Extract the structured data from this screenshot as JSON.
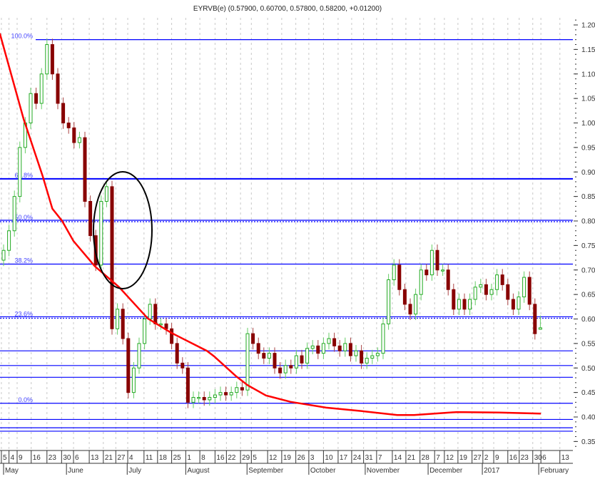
{
  "chart_data": {
    "type": "candlestick",
    "title": "EYRVB(e) (0.57900, 0.60700, 0.57800, 0.58200, +0.01200)",
    "last_bar": {
      "open": 0.579,
      "high": 0.607,
      "low": 0.578,
      "close": 0.582,
      "change": 0.012
    },
    "ylim": [
      0.33,
      1.215
    ],
    "y_ticks": [
      "1.20",
      "1.15",
      "1.10",
      "1.05",
      "1.00",
      "0.95",
      "0.90",
      "0.85",
      "0.80",
      "0.75",
      "0.70",
      "0.65",
      "0.60",
      "0.55",
      "0.50",
      "0.45",
      "0.40",
      "0.35"
    ],
    "y_tick_values": [
      1.2,
      1.15,
      1.1,
      1.05,
      1.0,
      0.95,
      0.9,
      0.85,
      0.8,
      0.75,
      0.7,
      0.65,
      0.6,
      0.55,
      0.5,
      0.45,
      0.4,
      0.35
    ],
    "x_day_ticks": [
      {
        "label": "5",
        "bar": -0.4
      },
      {
        "label": "4",
        "bar": 1.0
      },
      {
        "label": "9",
        "bar": 2.5
      },
      {
        "label": "16",
        "bar": 5.1
      },
      {
        "label": "23",
        "bar": 8.0
      },
      {
        "label": "30",
        "bar": 10.7
      },
      {
        "label": "6",
        "bar": 12.9
      },
      {
        "label": "13",
        "bar": 15.8
      },
      {
        "label": "21",
        "bar": 18.4
      },
      {
        "label": "27",
        "bar": 20.7
      },
      {
        "label": "4",
        "bar": 22.9
      },
      {
        "label": "11",
        "bar": 25.9
      },
      {
        "label": "18",
        "bar": 28.4
      },
      {
        "label": "25",
        "bar": 31.0
      },
      {
        "label": "1",
        "bar": 33.6
      },
      {
        "label": "8",
        "bar": 36.2
      },
      {
        "label": "16",
        "bar": 39.0
      },
      {
        "label": "22",
        "bar": 41.1
      },
      {
        "label": "29",
        "bar": 43.7
      },
      {
        "label": "5",
        "bar": 45.7
      },
      {
        "label": "12",
        "bar": 48.7
      },
      {
        "label": "19",
        "bar": 51.3
      },
      {
        "label": "26",
        "bar": 53.9
      },
      {
        "label": "3",
        "bar": 56.3
      },
      {
        "label": "10",
        "bar": 59.0
      },
      {
        "label": "17",
        "bar": 61.7
      },
      {
        "label": "24",
        "bar": 64.2
      },
      {
        "label": "31",
        "bar": 66.4
      },
      {
        "label": "7",
        "bar": 68.8
      },
      {
        "label": "14",
        "bar": 71.7
      },
      {
        "label": "21",
        "bar": 74.2
      },
      {
        "label": "28",
        "bar": 76.8
      },
      {
        "label": "7",
        "bar": 79.5
      },
      {
        "label": "12",
        "bar": 81.3
      },
      {
        "label": "19",
        "bar": 83.8
      },
      {
        "label": "27",
        "bar": 86.4
      },
      {
        "label": "2",
        "bar": 88.4
      },
      {
        "label": "9",
        "bar": 90.4
      },
      {
        "label": "16",
        "bar": 93.0
      },
      {
        "label": "23",
        "bar": 95.1
      },
      {
        "label": "30",
        "bar": 97.6
      },
      {
        "label": "6",
        "bar": 99.1
      },
      {
        "label": "13",
        "bar": 102.6
      }
    ],
    "x_month_ticks": [
      {
        "label": "May",
        "bar": 0.0
      },
      {
        "label": "June",
        "bar": 11.6
      },
      {
        "label": "July",
        "bar": 22.8
      },
      {
        "label": "August",
        "bar": 33.6
      },
      {
        "label": "September",
        "bar": 44.9
      },
      {
        "label": "October",
        "bar": 56.3
      },
      {
        "label": "November",
        "bar": 66.7
      },
      {
        "label": "December",
        "bar": 78.3
      },
      {
        "label": "2017",
        "bar": 88.3
      },
      {
        "label": "February",
        "bar": 98.7
      }
    ],
    "closes": [
      0.74,
      0.78,
      0.85,
      0.95,
      1.0,
      1.06,
      1.04,
      1.1,
      1.16,
      1.1,
      1.04,
      1.0,
      0.99,
      0.96,
      0.97,
      0.84,
      0.77,
      0.71,
      0.84,
      0.87,
      0.58,
      0.62,
      0.56,
      0.45,
      0.5,
      0.55,
      0.6,
      0.63,
      0.59,
      0.59,
      0.58,
      0.55,
      0.51,
      0.5,
      0.43,
      0.44,
      0.44,
      0.435,
      0.44,
      0.445,
      0.45,
      0.445,
      0.45,
      0.46,
      0.455,
      0.57,
      0.55,
      0.53,
      0.52,
      0.53,
      0.5,
      0.49,
      0.505,
      0.5,
      0.525,
      0.51,
      0.54,
      0.545,
      0.53,
      0.55,
      0.56,
      0.545,
      0.535,
      0.55,
      0.525,
      0.535,
      0.51,
      0.52,
      0.525,
      0.53,
      0.59,
      0.68,
      0.71,
      0.66,
      0.63,
      0.61,
      0.65,
      0.7,
      0.69,
      0.74,
      0.7,
      0.7,
      0.66,
      0.62,
      0.64,
      0.62,
      0.64,
      0.665,
      0.67,
      0.65,
      0.66,
      0.69,
      0.67,
      0.64,
      0.62,
      0.645,
      0.685,
      0.63,
      0.57,
      0.582
    ],
    "first_open": 0.72,
    "moving_average": {
      "color": "#ff0000",
      "points": [
        [
          -0.7,
          1.183
        ],
        [
          3.7,
          1.008
        ],
        [
          7.2,
          0.892
        ],
        [
          9.0,
          0.825
        ],
        [
          10.8,
          0.8
        ],
        [
          12.9,
          0.759
        ],
        [
          16.8,
          0.708
        ],
        [
          21.3,
          0.665
        ],
        [
          26.6,
          0.601
        ],
        [
          30.9,
          0.572
        ],
        [
          37.5,
          0.535
        ],
        [
          38.8,
          0.524
        ],
        [
          42.8,
          0.484
        ],
        [
          45.0,
          0.465
        ],
        [
          48.4,
          0.444
        ],
        [
          52.9,
          0.431
        ],
        [
          59.5,
          0.419
        ],
        [
          66.1,
          0.412
        ],
        [
          72.6,
          0.404
        ],
        [
          75.7,
          0.404
        ],
        [
          83.6,
          0.41
        ],
        [
          91.4,
          0.409
        ],
        [
          99.1,
          0.407
        ]
      ]
    },
    "fib_levels": [
      {
        "label": "100.0%",
        "price": 1.17,
        "style": "solid"
      },
      {
        "label": "61.8%",
        "price": 0.886,
        "style": "solid"
      },
      {
        "label": "50.0%",
        "price": 0.8,
        "style": "dotted"
      },
      {
        "label": "38.2%",
        "price": 0.712,
        "style": "solid"
      },
      {
        "label": "23.6%",
        "price": 0.603,
        "style": "dotted"
      },
      {
        "label": "0.0%",
        "price": 0.428,
        "style": "solid"
      }
    ],
    "extra_levels": [
      0.535,
      0.505,
      0.481,
      0.395,
      0.378,
      0.371
    ],
    "colors": {
      "up": "#22aa22",
      "down": "#880000",
      "level": "#0000ff",
      "grid": "#c8c8c8"
    }
  }
}
